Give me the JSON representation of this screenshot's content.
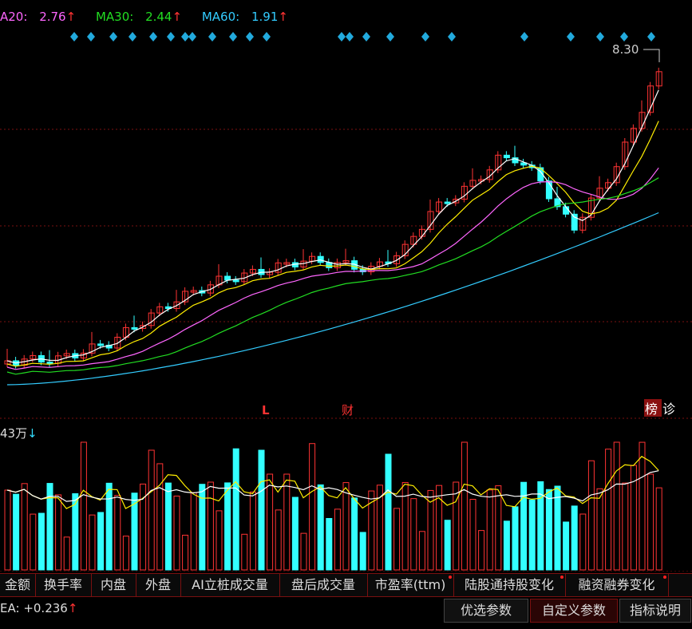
{
  "ma_legend": {
    "ma20": {
      "label": "A20:",
      "value": "2.76",
      "arrow": "↑",
      "color": "#ffffff"
    },
    "ma30": {
      "label": "MA30:",
      "value": "2.44",
      "arrow": "↑",
      "color": "#22dd22"
    },
    "ma60": {
      "label": "MA60:",
      "value": "1.91",
      "arrow": "↑",
      "color": "#33ccff"
    }
  },
  "price_high_label": "8.30",
  "event_markers": {
    "l": "L",
    "cai": "财",
    "bang": "榜",
    "zhen": "诊"
  },
  "volume_legend": {
    "value": "43万",
    "arrow": "↓"
  },
  "tabs": [
    {
      "label": "金额",
      "dot": false
    },
    {
      "label": "换手率",
      "dot": false
    },
    {
      "label": "内盘",
      "dot": false
    },
    {
      "label": "外盘",
      "dot": false
    },
    {
      "label": "AI立桩成交量",
      "dot": false
    },
    {
      "label": "盘后成交量",
      "dot": false
    },
    {
      "label": "市盈率(ttm)",
      "dot": true
    },
    {
      "label": "陆股通持股变化",
      "dot": true
    },
    {
      "label": "融资融券变化",
      "dot": true
    }
  ],
  "indicator": {
    "label": "EA:",
    "value": "+0.236",
    "arrow": "↑"
  },
  "buttons": {
    "preferred": "优选参数",
    "custom": "自定义参数",
    "help": "指标说明"
  },
  "colors": {
    "up": "#ff3333",
    "down": "#33ffff",
    "ma5": "#ffffff",
    "ma10": "#ffee00",
    "ma20": "#ff66ff",
    "ma30": "#22dd22",
    "ma60": "#33ccff",
    "grid": "#7a1010",
    "marker": "#22aadd"
  }
}
